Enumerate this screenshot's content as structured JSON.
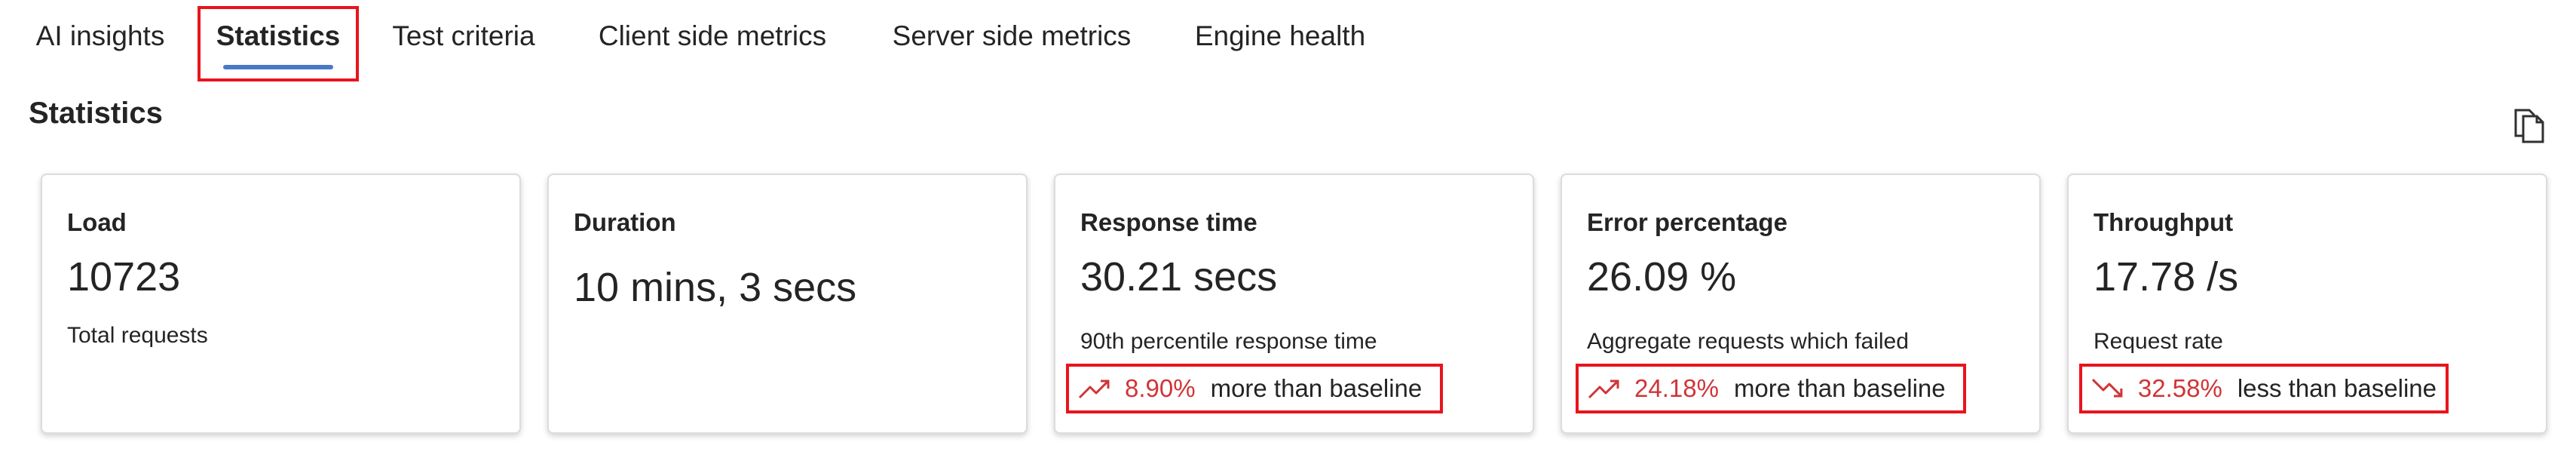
{
  "tabs": [
    {
      "label": "AI insights",
      "active": false
    },
    {
      "label": "Statistics",
      "active": true
    },
    {
      "label": "Test criteria",
      "active": false
    },
    {
      "label": "Client side metrics",
      "active": false
    },
    {
      "label": "Server side metrics",
      "active": false
    },
    {
      "label": "Engine health",
      "active": false
    }
  ],
  "section_title": "Statistics",
  "icons": {
    "copy": "copy-icon",
    "trend_up": "trending-up-icon",
    "trend_down": "trending-down-icon"
  },
  "colors": {
    "accent": "#4a78c8",
    "highlight": "#e8141d",
    "negative": "#d13438"
  },
  "cards": [
    {
      "title": "Load",
      "value": "10723",
      "subtitle": "Total requests"
    },
    {
      "title": "Duration",
      "value": "10 mins, 3 secs"
    },
    {
      "title": "Response time",
      "value": "30.21 secs",
      "subtitle": "90th percentile response time",
      "comparison": {
        "direction": "up",
        "percent": "8.90%",
        "text": "more than baseline"
      }
    },
    {
      "title": "Error percentage",
      "value": "26.09 %",
      "subtitle": "Aggregate requests which failed",
      "comparison": {
        "direction": "up",
        "percent": "24.18%",
        "text": "more than baseline"
      }
    },
    {
      "title": "Throughput",
      "value": "17.78 /s",
      "subtitle": "Request rate",
      "comparison": {
        "direction": "down",
        "percent": "32.58%",
        "text": "less than baseline"
      }
    }
  ]
}
